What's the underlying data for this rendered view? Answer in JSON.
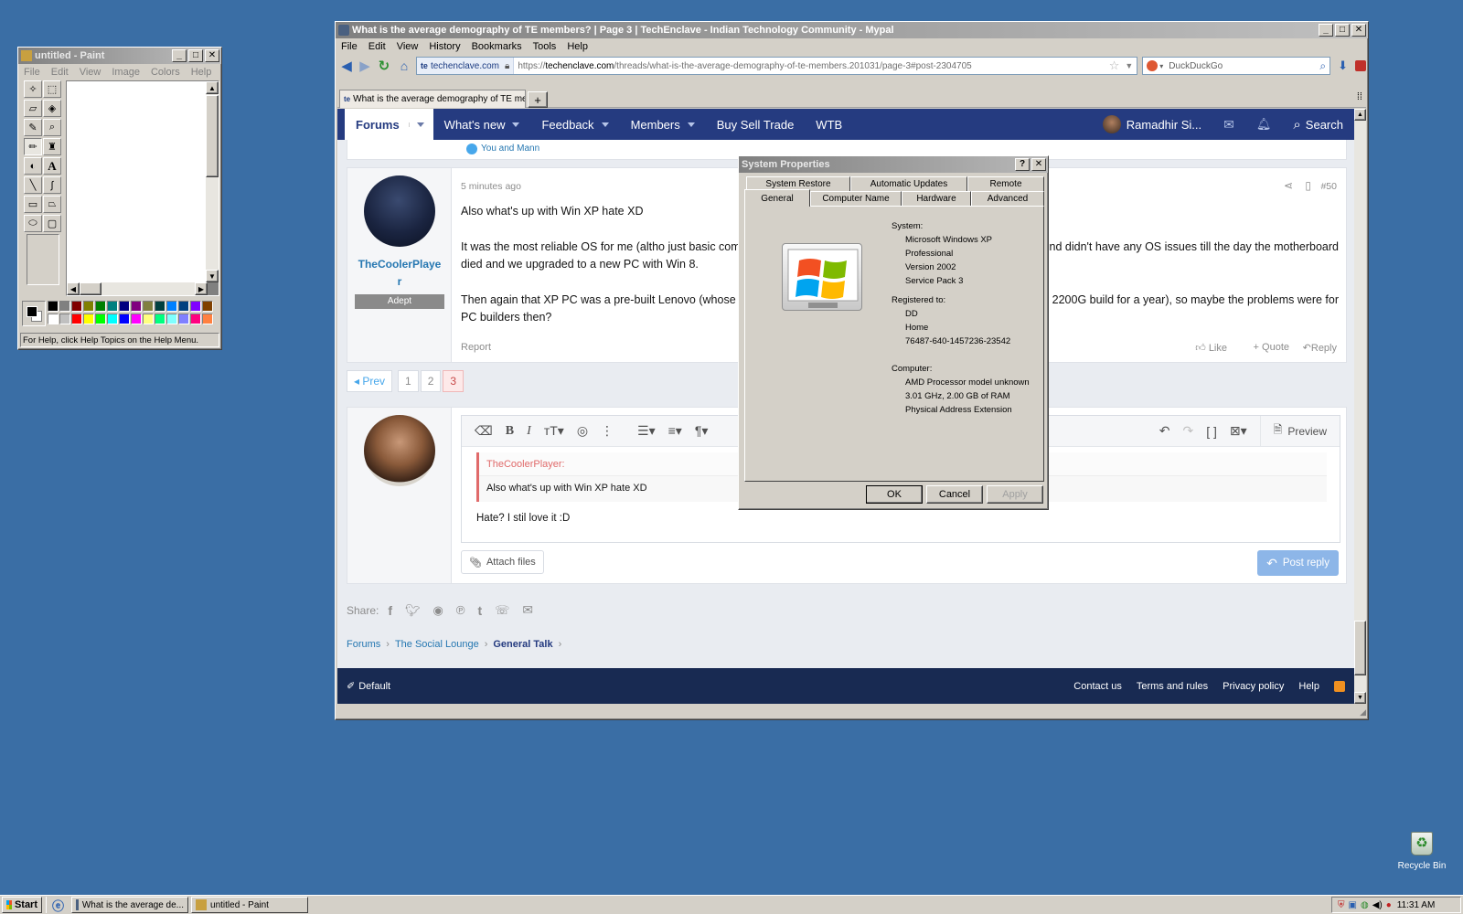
{
  "paint": {
    "title": "untitled - Paint",
    "menu": [
      "File",
      "Edit",
      "View",
      "Image",
      "Colors",
      "Help"
    ],
    "status": "For Help, click Help Topics on the Help Menu.",
    "palette": [
      "#000000",
      "#808080",
      "#800000",
      "#808000",
      "#008000",
      "#008080",
      "#000080",
      "#800080",
      "#808040",
      "#004040",
      "#0080ff",
      "#004080",
      "#8000ff",
      "#804000",
      "#ffffff",
      "#c0c0c0",
      "#ff0000",
      "#ffff00",
      "#00ff00",
      "#00ffff",
      "#0000ff",
      "#ff00ff",
      "#ffff80",
      "#00ff80",
      "#80ffff",
      "#8080ff",
      "#ff0080",
      "#ff8040"
    ]
  },
  "browser": {
    "title": "What is the average demography of TE members? | Page 3 | TechEnclave - Indian Technology Community - Mypal",
    "menu": [
      "File",
      "Edit",
      "View",
      "History",
      "Bookmarks",
      "Tools",
      "Help"
    ],
    "site_badge": "techenclave.com",
    "url_prefix": "https://",
    "url_domain": "techenclave.com",
    "url_path": "/threads/what-is-the-average-demography-of-te-members.201031/page-3#post-2304705",
    "search_engine": "DuckDuckGo",
    "tab_label": "What is the average demography of TE mem...",
    "new_tab": "+"
  },
  "forum": {
    "nav": [
      "Forums",
      "What's new",
      "Feedback",
      "Members",
      "Buy Sell Trade",
      "WTB"
    ],
    "user": "Ramadhir Si...",
    "search": "Search",
    "likes_prev": "You and Mann",
    "post": {
      "time": "5 minutes ago",
      "number": "#50",
      "author_line1": "TheCoolerPlaye",
      "author_line2": "r",
      "role": "Adept",
      "p1": "Also what's up with Win XP hate XD",
      "p2a": "It was the most reliable OS for me (altho just basic compu",
      "p2b": "nd didn't have any OS issues till the day the motherboard",
      "p2c": "died and we upgraded to a new PC with Win 8.",
      "p3a": "Then again that XP PC was a pre-built Lenovo (whose 250",
      "p3b": "ny 2200G build for a year), so maybe the problems were for",
      "p3c": "PC builders then?",
      "report": "Report",
      "like": "Like",
      "quote": "+ Quote",
      "reply": "Reply"
    },
    "pages": {
      "prev": "◂ Prev",
      "p1": "1",
      "p2": "2",
      "p3": "3"
    },
    "editor": {
      "quote_author": "TheCoolerPlayer:",
      "quote_text": "Also what's up with Win XP hate XD",
      "body": "Hate?  I stil love it :D",
      "preview": "Preview",
      "attach": "Attach files",
      "post_reply": "Post reply"
    },
    "share_label": "Share:",
    "breadcrumb": [
      "Forums",
      "The Social Lounge",
      "General Talk"
    ],
    "footer": {
      "style": "Default",
      "links": [
        "Contact us",
        "Terms and rules",
        "Privacy policy",
        "Help"
      ]
    }
  },
  "sysprops": {
    "title": "System Properties",
    "tabs_top": [
      "System Restore",
      "Automatic Updates",
      "Remote"
    ],
    "tabs_bottom": [
      "General",
      "Computer Name",
      "Hardware",
      "Advanced"
    ],
    "system_label": "System:",
    "system": [
      "Microsoft Windows XP",
      "Professional",
      "Version 2002",
      "Service Pack 3"
    ],
    "registered_label": "Registered to:",
    "registered": [
      "DD",
      "Home",
      "76487-640-1457236-23542"
    ],
    "computer_label": "Computer:",
    "computer": [
      "AMD Processor model unknown",
      "3.01 GHz, 2.00 GB of RAM",
      "Physical Address Extension"
    ],
    "ok": "OK",
    "cancel": "Cancel",
    "apply": "Apply"
  },
  "desktop": {
    "recycle_bin": "Recycle Bin"
  },
  "taskbar": {
    "start": "Start",
    "items": [
      "What is the average de...",
      "untitled - Paint"
    ],
    "clock": "11:31 AM"
  }
}
